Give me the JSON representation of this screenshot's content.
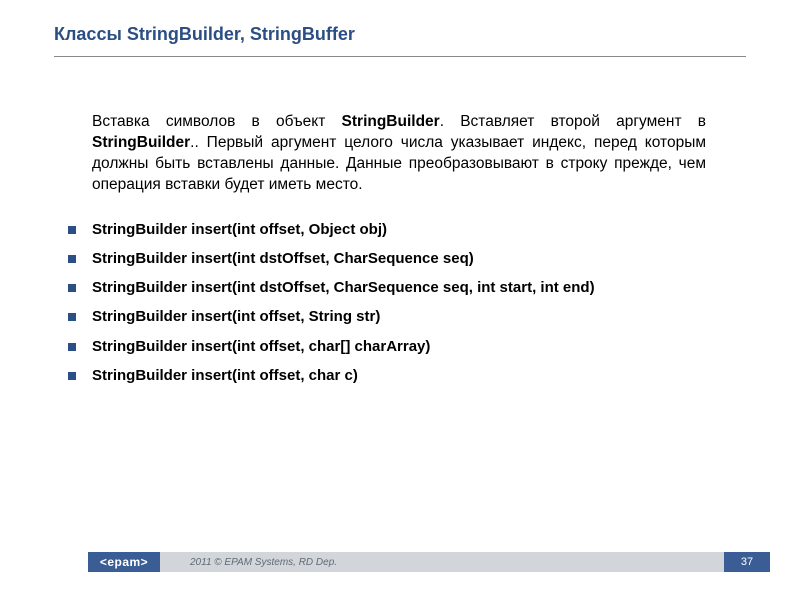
{
  "title": "Классы StringBuilder, StringBuffer",
  "paragraph": {
    "seg1": "Вставка символов в объект ",
    "bold1": "StringBuilder",
    "seg2": ". Вставляет второй аргумент в ",
    "bold2": "StringBuilder",
    "seg3": ".. Первый аргумент целого числа указывает индекс, перед которым должны быть вставлены данные. Данные преобразовывают в строку прежде, чем операция вставки будет иметь место."
  },
  "methods": [
    "StringBuilder insert(int offset, Object obj)",
    "StringBuilder insert(int dstOffset, CharSequence seq)",
    "StringBuilder insert(int dstOffset, CharSequence seq, int start, int end)",
    "StringBuilder insert(int offset, String str)",
    "StringBuilder insert(int offset, char[] charArray)",
    "StringBuilder insert(int offset, char c)"
  ],
  "footer": {
    "logo": "<epam>",
    "copyright": "2011 © EPAM Systems, RD Dep.",
    "page": "37"
  }
}
